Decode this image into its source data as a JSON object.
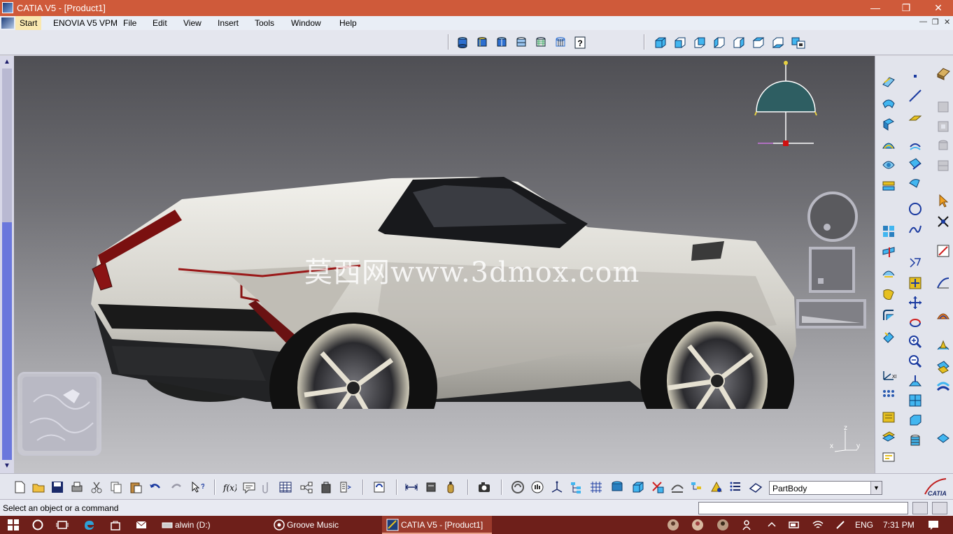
{
  "window": {
    "title": "CATIA V5 - [Product1]",
    "minimize_glyph": "—",
    "maximize_glyph": "❐",
    "close_glyph": "✕"
  },
  "menubar": {
    "items": [
      "Start",
      "ENOVIA V5 VPM",
      "File",
      "Edit",
      "View",
      "Insert",
      "Tools",
      "Window",
      "Help"
    ],
    "doc_controls": [
      "—",
      "❐",
      "✕"
    ]
  },
  "viewport": {
    "watermark": "莫西网www.3dmox.com",
    "axis_labels": {
      "x": "x",
      "y": "y",
      "z": "z"
    },
    "compass_label": "z"
  },
  "bottom_toolbar": {
    "current_body": "PartBody"
  },
  "statusbar": {
    "message": "Select an object or a command",
    "command_value": ""
  },
  "taskbar": {
    "items": [
      {
        "label": "alwin (D:)"
      },
      {
        "label": "Groove Music"
      },
      {
        "label": "CATIA V5 - [Product1]"
      }
    ],
    "language": "ENG",
    "time": "7:31 PM"
  },
  "colors": {
    "titlebar": "#cf5a3a",
    "taskbar": "#6e1f1a",
    "accent": "#2ea1d6",
    "viewport_top": "#4f4f54",
    "viewport_bottom": "#c4c4c8"
  }
}
